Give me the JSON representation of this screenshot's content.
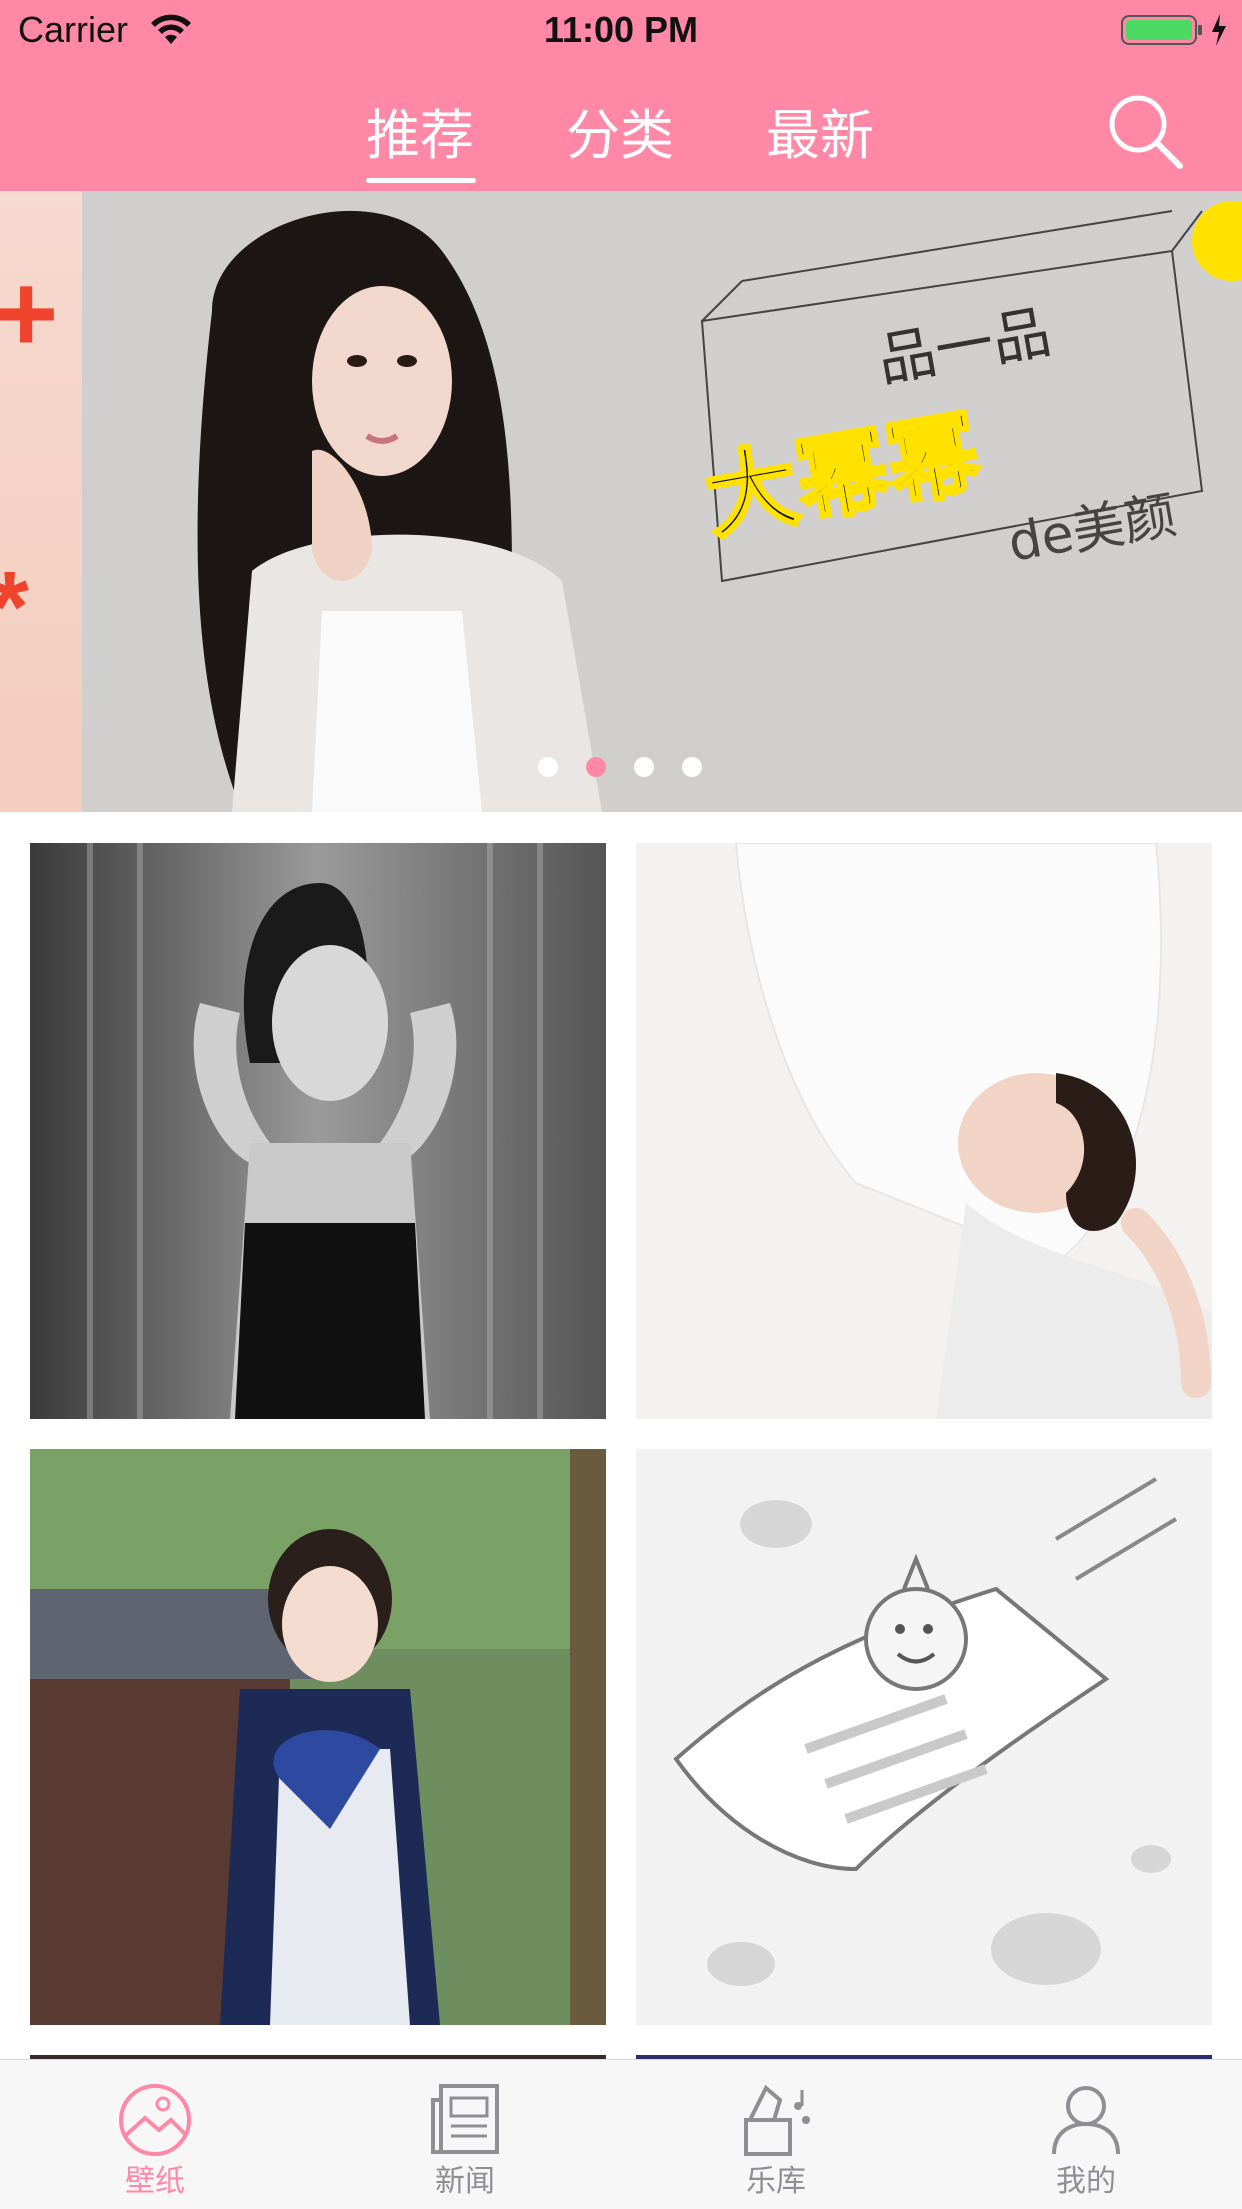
{
  "status_bar": {
    "carrier": "Carrier",
    "time": "11:00 PM",
    "icons": [
      "wifi-icon",
      "battery-icon",
      "charging-bolt-icon"
    ]
  },
  "header": {
    "tabs": [
      {
        "label": "推荐",
        "selected": true
      },
      {
        "label": "分类",
        "selected": false
      },
      {
        "label": "最新",
        "selected": false
      }
    ],
    "search_icon": "search-icon",
    "background": "#ff88a6"
  },
  "banner": {
    "caption": {
      "line1": "品一品",
      "line2": "大幂幂",
      "line3": "de美颜"
    },
    "page_count": 4,
    "active_page": 2
  },
  "wallpapers": [
    {
      "kind": "photo"
    },
    {
      "kind": "photo"
    },
    {
      "kind": "photo"
    },
    {
      "kind": "placeholder",
      "icon": "loading-placeholder-illustration"
    },
    {
      "kind": "photo"
    },
    {
      "kind": "photo"
    }
  ],
  "tabbar": {
    "items": [
      {
        "label": "壁纸",
        "icon": "wallpaper-icon",
        "selected": true
      },
      {
        "label": "新闻",
        "icon": "news-icon",
        "selected": false
      },
      {
        "label": "乐库",
        "icon": "music-library-icon",
        "selected": false
      },
      {
        "label": "我的",
        "icon": "profile-icon",
        "selected": false
      }
    ],
    "accent": "#ff88a6",
    "inactive": "#8e8e93"
  }
}
